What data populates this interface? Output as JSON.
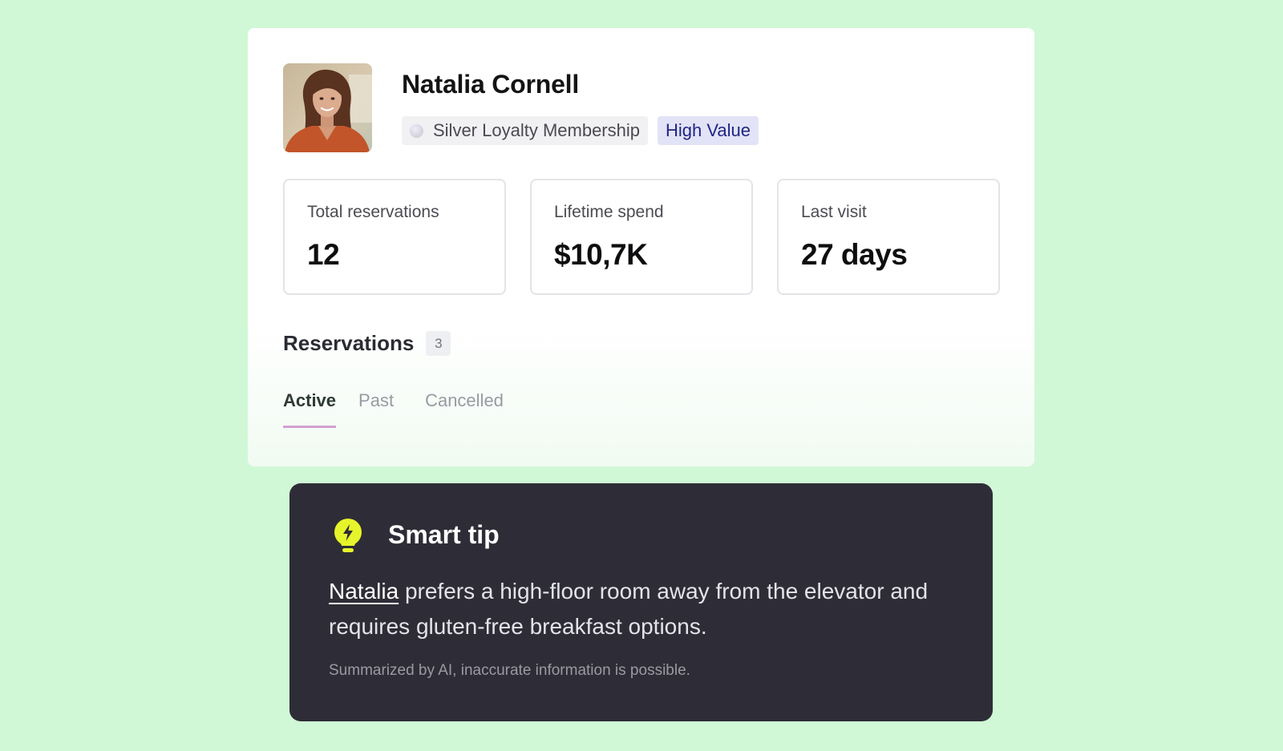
{
  "guest": {
    "name": "Natalia Cornell",
    "loyalty_label": "Silver Loyalty Membership",
    "value_label": "High Value"
  },
  "stats": [
    {
      "label": "Total reservations",
      "value": "12"
    },
    {
      "label": "Lifetime spend",
      "value": "$10,7K"
    },
    {
      "label": "Last visit",
      "value": "27 days"
    }
  ],
  "reservations": {
    "title": "Reservations",
    "count": "3",
    "tabs": [
      {
        "label": "Active",
        "active": true
      },
      {
        "label": "Past",
        "active": false
      },
      {
        "label": "Cancelled",
        "active": false
      }
    ]
  },
  "tip": {
    "icon": "lightbulb-bolt-icon",
    "title": "Smart tip",
    "name_link": "Natalia",
    "body_rest": " prefers a high-floor room away from the elevator and requires gluten-free breakfast options.",
    "note": "Summarized by AI, inaccurate information is possible."
  },
  "colors": {
    "background": "#d0f8d6",
    "tab_indicator": "#d39fce",
    "high_value_bg": "#e2e3f6",
    "high_value_text": "#202585",
    "tip_bg": "#2e2d37",
    "tip_icon": "#e6f52a"
  }
}
